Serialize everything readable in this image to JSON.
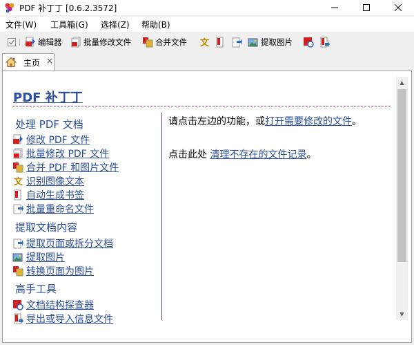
{
  "window": {
    "title": "PDF 补丁丁 [0.6.2.3572]"
  },
  "menu": [
    "文件(W)",
    "工具箱(G)",
    "选择(Z)",
    "帮助(B)"
  ],
  "toolbar": {
    "editor": "编辑器",
    "batch_modify": "批量修改文件",
    "merge": "合并文件",
    "extract_images": "提取图片"
  },
  "tab": {
    "label": "主页",
    "close": "×"
  },
  "content": {
    "title": "PDF 补丁丁",
    "sections": [
      {
        "heading": "处理 PDF 文档",
        "links": [
          "修改 PDF 文件",
          "批量修改 PDF 文件",
          "合并 PDF 和图片文件",
          "识别图像文本",
          "自动生成书签",
          "批量重命名文件"
        ]
      },
      {
        "heading": "提取文档内容",
        "links": [
          "提取页面或拆分文档",
          "提取图片",
          "转换页面为图片"
        ]
      },
      {
        "heading": "高手工具",
        "links": [
          "文档结构探查器",
          "导出或导入信息文件"
        ]
      }
    ],
    "right": {
      "line1_prefix": "请点击左边的功能，或",
      "line1_link": "打开需要修改的文件",
      "line1_suffix": "。",
      "line2_prefix": "点击此处 ",
      "line2_link": "清理不存在的文件记录",
      "line2_suffix": "。"
    }
  },
  "colors": {
    "link": "#2b4f9e",
    "divider": "#6a3c8a",
    "rule": "#a04590"
  }
}
